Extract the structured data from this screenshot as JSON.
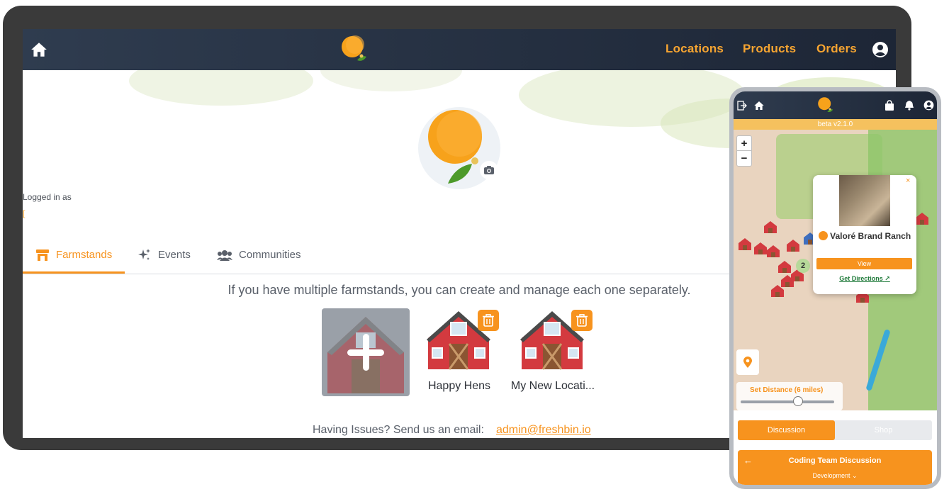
{
  "desktop": {
    "nav": {
      "home_icon": "home-icon",
      "links": [
        "Locations",
        "Products",
        "Orders"
      ],
      "user_icon": "user-circle-icon"
    },
    "profile": {
      "logged_in_label": "Logged in as",
      "logged_in_name": "[",
      "camera_icon": "camera-icon"
    },
    "tabs": [
      {
        "label": "Farmstands",
        "icon": "store-icon",
        "active": true
      },
      {
        "label": "Events",
        "icon": "sparkles-icon",
        "active": false
      },
      {
        "label": "Communities",
        "icon": "users-icon",
        "active": false
      }
    ],
    "farmstands": {
      "intro": "If you have multiple farmstands, you can create and manage each one separately.",
      "add_icon": "plus-icon",
      "items": [
        {
          "name": "Happy Hens",
          "delete_icon": "trash-icon"
        },
        {
          "name": "My New Locati...",
          "delete_icon": "trash-icon"
        }
      ]
    },
    "help": {
      "text": "Having Issues? Send us an email:",
      "email": "admin@freshbin.io"
    }
  },
  "mobile": {
    "nav": {
      "icons": [
        "logout-icon",
        "home-icon",
        "bag-icon",
        "bell-icon",
        "user-circle-icon"
      ]
    },
    "beta_label": "beta v2.1.0",
    "map": {
      "zoom_in": "+",
      "zoom_out": "−",
      "cluster_count": "2",
      "popup": {
        "close": "×",
        "title": "Valoré Brand Ranch",
        "view_label": "View",
        "directions_label": "Get Directions"
      },
      "distance_label": "Set Distance (6 miles)",
      "distance_miles": 6
    },
    "tabs": [
      "Discussion",
      "Shop"
    ],
    "discussion": {
      "back_icon": "arrow-left-icon",
      "title": "Coding Team Discussion",
      "subtitle": "Development"
    }
  },
  "colors": {
    "accent": "#f7931e",
    "navbar": "#1d2636",
    "beta_bar": "#f5c15e"
  }
}
